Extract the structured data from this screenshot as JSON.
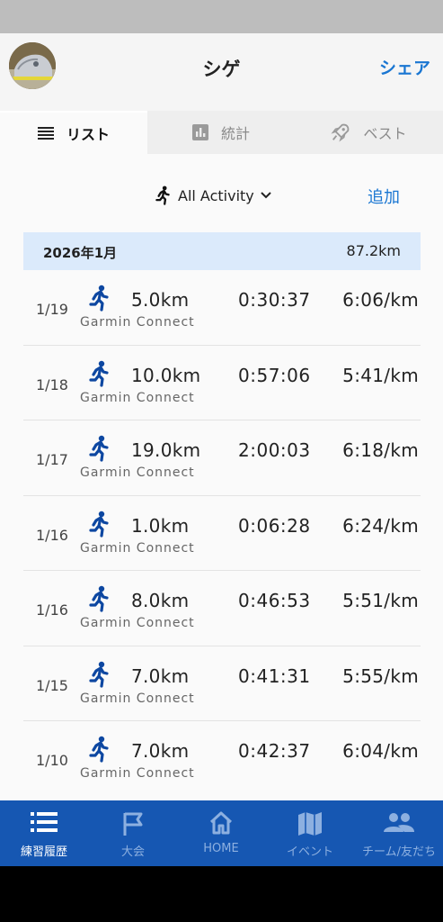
{
  "header": {
    "title": "シゲ",
    "share_label": "シェア"
  },
  "tabs": [
    {
      "label": "リスト",
      "icon": "list-icon",
      "active": true
    },
    {
      "label": "統計",
      "icon": "bar-chart-icon",
      "active": false
    },
    {
      "label": "ベスト",
      "icon": "rocket-icon",
      "active": false
    }
  ],
  "filter": {
    "label": "All Activity",
    "icon": "runner-icon",
    "add_label": "追加"
  },
  "month": {
    "label": "2026年1月",
    "total": "87.2km"
  },
  "activities": [
    {
      "date": "1/19",
      "distance": "5.0km",
      "source": "Garmin Connect",
      "time": "0:30:37",
      "pace": "6:06/km"
    },
    {
      "date": "1/18",
      "distance": "10.0km",
      "source": "Garmin Connect",
      "time": "0:57:06",
      "pace": "5:41/km"
    },
    {
      "date": "1/17",
      "distance": "19.0km",
      "source": "Garmin Connect",
      "time": "2:00:03",
      "pace": "6:18/km"
    },
    {
      "date": "1/16",
      "distance": "1.0km",
      "source": "Garmin Connect",
      "time": "0:06:28",
      "pace": "6:24/km"
    },
    {
      "date": "1/16",
      "distance": "8.0km",
      "source": "Garmin Connect",
      "time": "0:46:53",
      "pace": "5:51/km"
    },
    {
      "date": "1/15",
      "distance": "7.0km",
      "source": "Garmin Connect",
      "time": "0:41:31",
      "pace": "5:55/km"
    },
    {
      "date": "1/10",
      "distance": "7.0km",
      "source": "Garmin Connect",
      "time": "0:42:37",
      "pace": "6:04/km"
    }
  ],
  "nav": [
    {
      "label": "練習履歴",
      "icon": "list-icon",
      "active": true
    },
    {
      "label": "大会",
      "icon": "flag-icon",
      "active": false
    },
    {
      "label": "HOME",
      "icon": "home-icon",
      "active": false
    },
    {
      "label": "イベント",
      "icon": "map-icon",
      "active": false
    },
    {
      "label": "チーム/友だち",
      "icon": "people-icon",
      "active": false
    }
  ],
  "colors": {
    "accent": "#1976d2",
    "nav_bg": "#1657b2",
    "runner_icon": "#0d47a1",
    "month_bar": "#dbeafb"
  }
}
